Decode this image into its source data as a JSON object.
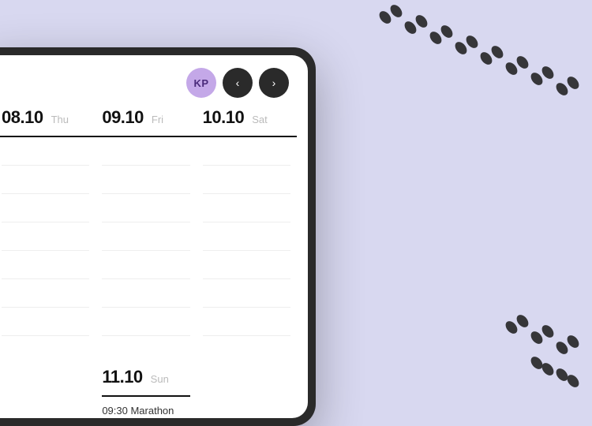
{
  "background_color": "#d8d8f0",
  "avatar": {
    "initials": "KP",
    "bg_color": "#c4a8e8",
    "text_color": "#4a2a7a"
  },
  "nav": {
    "prev_label": "‹",
    "next_label": "›"
  },
  "columns": [
    {
      "date": "08.10",
      "day": "Thu"
    },
    {
      "date": "09.10",
      "day": "Fri"
    },
    {
      "date": "10.10",
      "day": "Sat"
    }
  ],
  "bottom_column": {
    "date": "11.10",
    "day": "Sun",
    "event": "09:30 Marathon"
  },
  "line_count": 8
}
